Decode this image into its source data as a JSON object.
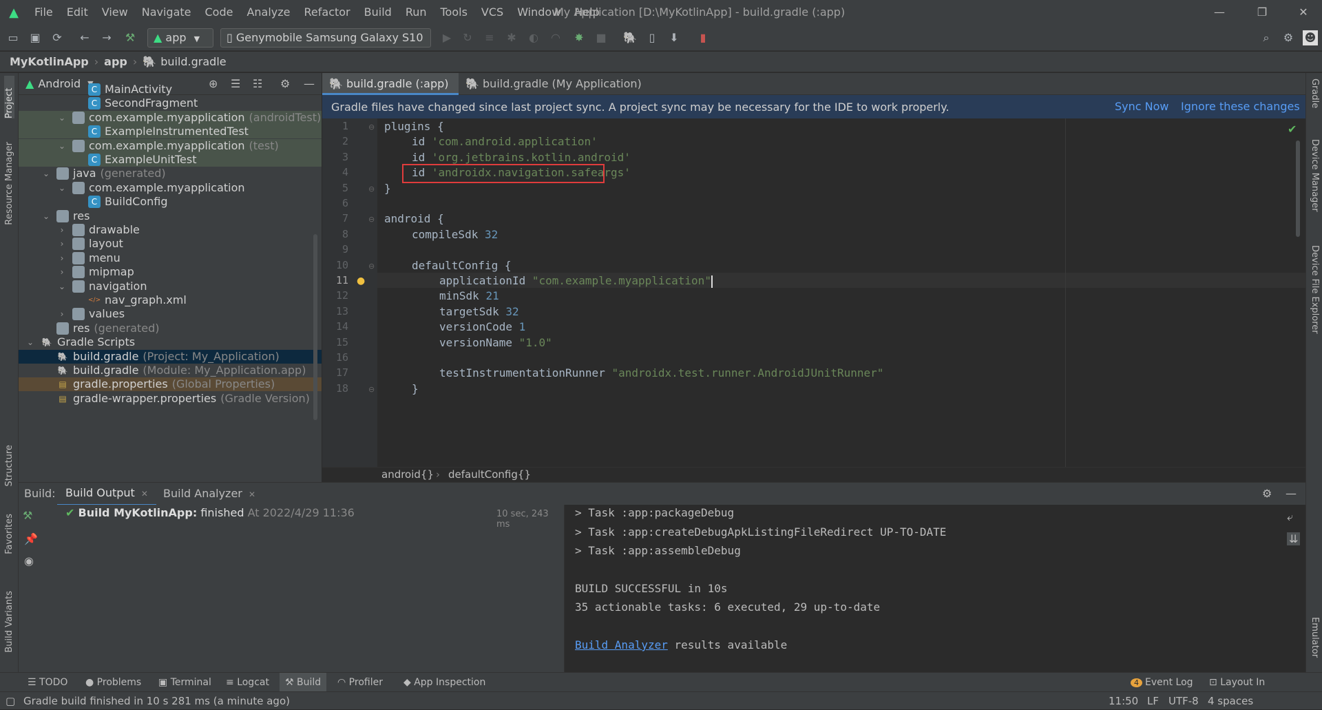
{
  "menubar": {
    "items": [
      "File",
      "Edit",
      "View",
      "Navigate",
      "Code",
      "Analyze",
      "Refactor",
      "Build",
      "Run",
      "Tools",
      "VCS",
      "Window",
      "Help"
    ],
    "window_title": "My Application [D:\\MyKotlinApp] - build.gradle (:app)"
  },
  "toolbar": {
    "run_config": "app",
    "device": "Genymobile Samsung Galaxy S10"
  },
  "navbar": {
    "crumbs": [
      "MyKotlinApp",
      "app",
      "build.gradle"
    ]
  },
  "left_strip": {
    "project": "Project",
    "resource_manager": "Resource Manager",
    "structure": "Structure",
    "favorites": "Favorites",
    "build_variants": "Build Variants"
  },
  "right_strip": {
    "gradle": "Gradle",
    "device_manager": "Device Manager",
    "device_file_explorer": "Device File Explorer",
    "emulator": "Emulator"
  },
  "project": {
    "view_mode": "Android",
    "tree": [
      {
        "label": "MainActivity",
        "sub": ""
      },
      {
        "label": "SecondFragment",
        "sub": ""
      },
      {
        "label": "com.example.myapplication",
        "sub": "(androidTest)"
      },
      {
        "label": "ExampleInstrumentedTest",
        "sub": ""
      },
      {
        "label": "com.example.myapplication",
        "sub": "(test)"
      },
      {
        "label": "ExampleUnitTest",
        "sub": ""
      },
      {
        "label": "java",
        "sub": "(generated)"
      },
      {
        "label": "com.example.myapplication",
        "sub": ""
      },
      {
        "label": "BuildConfig",
        "sub": ""
      },
      {
        "label": "res",
        "sub": ""
      },
      {
        "label": "drawable",
        "sub": ""
      },
      {
        "label": "layout",
        "sub": ""
      },
      {
        "label": "menu",
        "sub": ""
      },
      {
        "label": "mipmap",
        "sub": ""
      },
      {
        "label": "navigation",
        "sub": ""
      },
      {
        "label": "nav_graph.xml",
        "sub": ""
      },
      {
        "label": "values",
        "sub": ""
      },
      {
        "label": "res",
        "sub": "(generated)"
      },
      {
        "label": "Gradle Scripts",
        "sub": ""
      },
      {
        "label": "build.gradle",
        "sub": "(Project: My_Application)"
      },
      {
        "label": "build.gradle",
        "sub": "(Module: My_Application.app)"
      },
      {
        "label": "gradle.properties",
        "sub": "(Global Properties)"
      },
      {
        "label": "gradle-wrapper.properties",
        "sub": "(Gradle Version)"
      }
    ]
  },
  "editor": {
    "tabs": [
      "build.gradle (:app)",
      "build.gradle (My Application)"
    ],
    "banner_text": "Gradle files have changed since last project sync. A project sync may be necessary for the IDE to work properly.",
    "sync_now": "Sync Now",
    "ignore_changes": "Ignore these changes",
    "line_numbers": [
      "1",
      "2",
      "3",
      "4",
      "5",
      "6",
      "7",
      "8",
      "9",
      "10",
      "11",
      "12",
      "13",
      "14",
      "15",
      "16",
      "17",
      "18"
    ],
    "lines": {
      "l1": "plugins {",
      "l2_kw": "id ",
      "l2_str": "'com.android.application'",
      "l3_kw": "id ",
      "l3_str": "'org.jetbrains.kotlin.android'",
      "l4_kw": "id ",
      "l4_str": "'androidx.navigation.safeargs'",
      "l5": "}",
      "l7": "android {",
      "l8_kw": "compileSdk ",
      "l8_num": "32",
      "l10": "defaultConfig {",
      "l11_kw": "applicationId ",
      "l11_str": "\"com.example.myapplication\"",
      "l12_kw": "minSdk ",
      "l12_num": "21",
      "l13_kw": "targetSdk ",
      "l13_num": "32",
      "l14_kw": "versionCode ",
      "l14_num": "1",
      "l15_kw": "versionName ",
      "l15_str": "\"1.0\"",
      "l17_kw": "testInstrumentationRunner ",
      "l17_str": "\"androidx.test.runner.AndroidJUnitRunner\"",
      "l18": "}"
    },
    "breadcrumb": [
      "android{}",
      "defaultConfig{}"
    ]
  },
  "build": {
    "label": "Build:",
    "tabs": [
      "Build Output",
      "Build Analyzer"
    ],
    "result_title": "Build MyKotlinApp:",
    "result_status": "finished",
    "result_time": "At 2022/4/29 11:36",
    "duration": "10 sec, 243 ms",
    "console": {
      "c1": "> Task :app:packageDebug",
      "c2": "> Task :app:createDebugApkListingFileRedirect UP-TO-DATE",
      "c3": "> Task :app:assembleDebug",
      "c4": "BUILD SUCCESSFUL in 10s",
      "c5": "35 actionable tasks: 6 executed, 29 up-to-date",
      "c6_link": "Build Analyzer",
      "c6_rest": " results available"
    }
  },
  "bottom_tabs": {
    "todo": "TODO",
    "problems": "Problems",
    "terminal": "Terminal",
    "logcat": "Logcat",
    "build": "Build",
    "profiler": "Profiler",
    "app_inspection": "App Inspection",
    "event_log_count": "4",
    "event_log": "Event Log",
    "layout_inspector": "Layout In"
  },
  "statusbar": {
    "message": "Gradle build finished in 10 s 281 ms (a minute ago)",
    "position": "11:50",
    "line_sep": "LF",
    "encoding": "UTF-8",
    "indent": "4 spaces"
  },
  "colors": {
    "accent": "#4a88c7",
    "string": "#6a8759",
    "number": "#6897bb",
    "highlight_box": "#e03c3c",
    "banner": "#293c57",
    "link": "#589df6"
  }
}
